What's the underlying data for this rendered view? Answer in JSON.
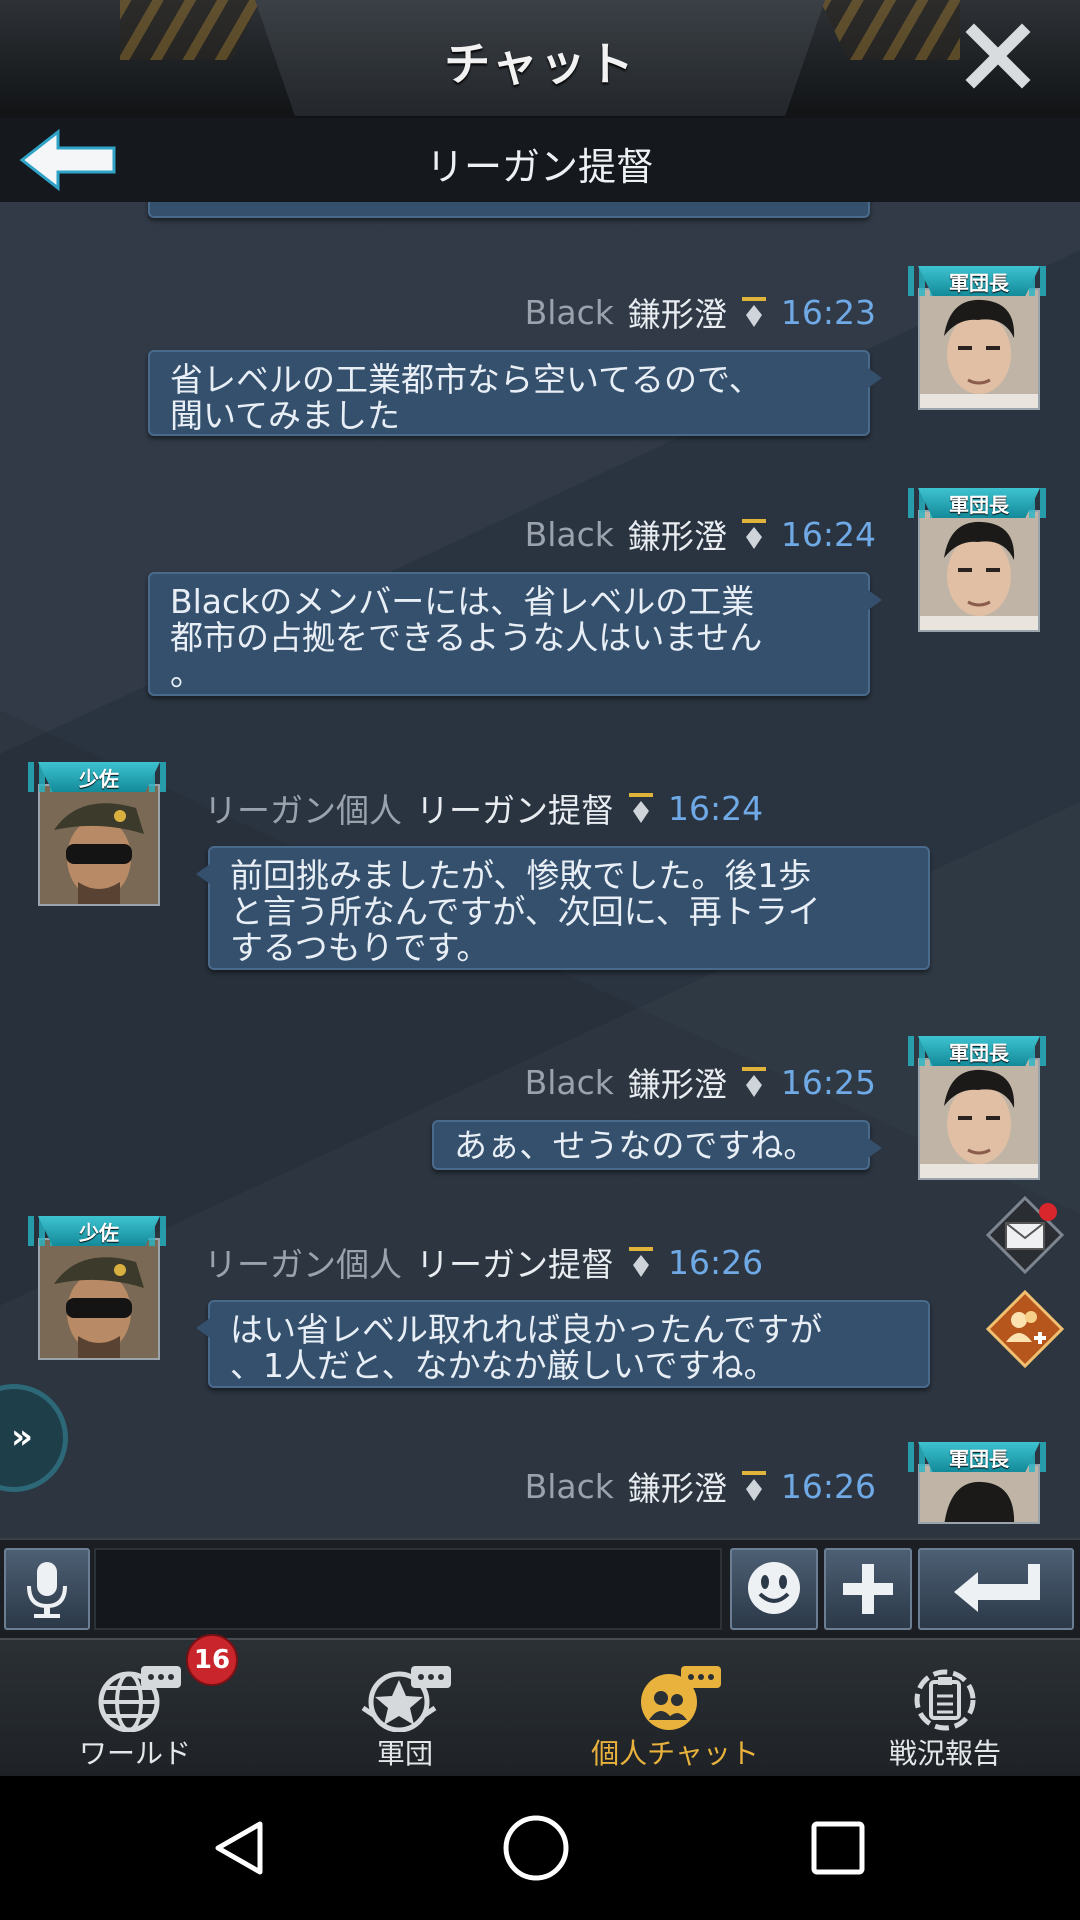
{
  "header": {
    "title": "チャット"
  },
  "subheader": {
    "title": "リーガン提督"
  },
  "messages": [
    {
      "side": "right",
      "tag": "Black",
      "name": "鎌形澄",
      "time": "16:23",
      "badge": "軍団長",
      "text": "省レベルの工業都市なら空いてるので、\n聞いてみました"
    },
    {
      "side": "right",
      "tag": "Black",
      "name": "鎌形澄",
      "time": "16:24",
      "badge": "軍団長",
      "text": "Blackのメンバーには、省レベルの工業\n都市の占拠をできるような人はいません\n。"
    },
    {
      "side": "left",
      "tag": "リーガン個人",
      "name": "リーガン提督",
      "time": "16:24",
      "badge": "少佐",
      "text": "前回挑みましたが、惨敗でした。後1歩\nと言う所なんですが、次回に、再トライ\nするつもりです。"
    },
    {
      "side": "right",
      "tag": "Black",
      "name": "鎌形澄",
      "time": "16:25",
      "badge": "軍団長",
      "text": "あぁ、せうなのですね。"
    },
    {
      "side": "left",
      "tag": "リーガン個人",
      "name": "リーガン提督",
      "time": "16:26",
      "badge": "少佐",
      "text": "はい省レベル取れれば良かったんですが\n、1人だと、なかなか厳しいですね。"
    },
    {
      "side": "right",
      "tag": "Black",
      "name": "鎌形澄",
      "time": "16:26",
      "badge": "軍団長",
      "text": ""
    }
  ],
  "side_tab": {
    "label": "»"
  },
  "input": {
    "value": "",
    "placeholder": ""
  },
  "nav": [
    {
      "label": "ワールド",
      "icon": "globe-chat-icon",
      "badge": "16",
      "active": false
    },
    {
      "label": "軍団",
      "icon": "star-chat-icon",
      "active": false
    },
    {
      "label": "個人チャット",
      "icon": "people-chat-icon",
      "active": true
    },
    {
      "label": "戦況報告",
      "icon": "report-icon",
      "active": false
    }
  ],
  "colors": {
    "bubble": "#35506d",
    "time": "#6fa9e6",
    "active_nav": "#e9b23c",
    "chat_bg": "#2a3440"
  }
}
